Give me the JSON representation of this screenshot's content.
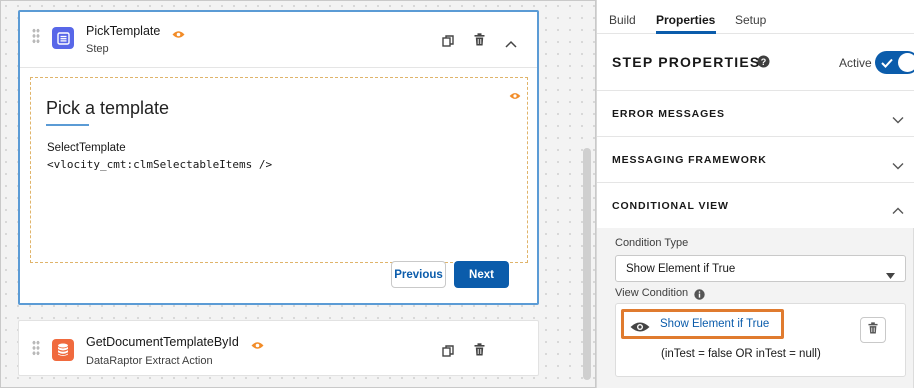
{
  "canvas": {
    "step": {
      "title": "PickTemplate",
      "subtitle": "Step",
      "icon": "list-icon",
      "icon_color": "#5867e8",
      "content": {
        "heading": "Pick a template",
        "field_label": "SelectTemplate",
        "field_code": "<vlocity_cmt:clmSelectableItems />"
      },
      "buttons": {
        "previous": "Previous",
        "next": "Next"
      }
    },
    "action": {
      "title": "GetDocumentTemplateById",
      "subtitle": "DataRaptor Extract Action",
      "icon": "database-icon",
      "icon_color": "#f06a3e"
    }
  },
  "panel": {
    "tabs": [
      {
        "label": "Build",
        "active": false
      },
      {
        "label": "Properties",
        "active": true
      },
      {
        "label": "Setup",
        "active": false
      }
    ],
    "title": "STEP PROPERTIES",
    "active_label": "Active",
    "active_on": true,
    "sections": [
      {
        "label": "ERROR MESSAGES",
        "expanded": false
      },
      {
        "label": "MESSAGING FRAMEWORK",
        "expanded": false
      },
      {
        "label": "CONDITIONAL VIEW",
        "expanded": true
      }
    ],
    "conditional_view": {
      "condition_type_label": "Condition Type",
      "condition_type_value": "Show Element if True",
      "view_condition_label": "View Condition",
      "link_text": "Show Element if True",
      "expression": "(inTest = false OR inTest = null)"
    }
  },
  "colors": {
    "brand": "#0b5cab",
    "highlight": "#e07b2f",
    "step_border": "#5b9bd5",
    "eye_orange": "#f28c28"
  }
}
